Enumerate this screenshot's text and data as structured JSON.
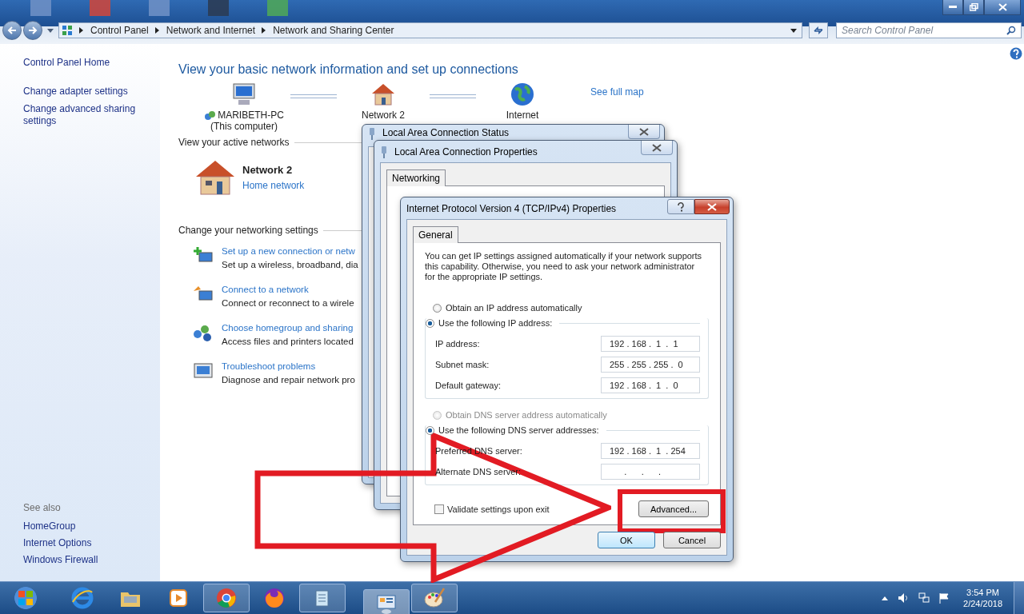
{
  "window": {
    "breadcrumb": [
      "Control Panel",
      "Network and Internet",
      "Network and Sharing Center"
    ],
    "search": {
      "placeholder": "Search Control Panel"
    }
  },
  "sidebar": {
    "items": [
      "Control Panel Home",
      "Change adapter settings",
      "Change advanced sharing settings"
    ],
    "see_also_title": "See also",
    "see_also": [
      "HomeGroup",
      "Internet Options",
      "Windows Firewall"
    ]
  },
  "main": {
    "heading": "View your basic network information and set up connections",
    "map": {
      "nodes": [
        {
          "kind": "computer",
          "label": "MARIBETH-PC",
          "sublabel": "(This computer)"
        },
        {
          "kind": "house",
          "label": "Network  2"
        },
        {
          "kind": "globe",
          "label": "Internet"
        }
      ],
      "full_map_link": "See full map"
    },
    "active_networks": {
      "title": "View your active networks",
      "name": "Network  2",
      "type": "Home network"
    },
    "settings": {
      "title": "Change your networking settings",
      "tasks": [
        {
          "kind": "new-connection",
          "link": "Set up a new connection or netw",
          "description": "Set up a wireless, broadband, dia"
        },
        {
          "kind": "connect",
          "link": "Connect to a network",
          "description": "Connect or reconnect to a wirele"
        },
        {
          "kind": "homegroup",
          "link": "Choose homegroup and sharing",
          "description": "Access files and printers located"
        },
        {
          "kind": "troubleshoot",
          "link": "Troubleshoot problems",
          "description": "Diagnose and repair network pro"
        }
      ]
    }
  },
  "dialogs": {
    "status": {
      "title": "Local Area Connection Status"
    },
    "properties": {
      "title": "Local Area Connection Properties",
      "tabs": [
        {
          "label": "Networking",
          "selected": true
        }
      ]
    },
    "ipv4": {
      "title": "Internet Protocol Version 4 (TCP/IPv4) Properties",
      "tabs": [
        {
          "label": "General",
          "selected": true
        }
      ],
      "description": "You can get IP settings assigned automatically if your network supports this capability. Otherwise, you need to ask your network administrator for the appropriate IP settings.",
      "ip_options": [
        {
          "label": "Obtain an IP address automatically",
          "selected": false,
          "disabled": false
        },
        {
          "label": "Use the following IP address:",
          "selected": true,
          "disabled": false
        }
      ],
      "ip_fields": [
        {
          "label": "IP address:",
          "value": "192 . 168 .  1  .  1"
        },
        {
          "label": "Subnet mask:",
          "value": "255 . 255 . 255 .  0"
        },
        {
          "label": "Default gateway:",
          "value": "192 . 168 .  1  .  0"
        }
      ],
      "dns_options": [
        {
          "label": "Obtain DNS server address automatically",
          "selected": false,
          "disabled": true
        },
        {
          "label": "Use the following DNS server addresses:",
          "selected": true,
          "disabled": false
        }
      ],
      "dns_fields": [
        {
          "label": "Preferred DNS server:",
          "value": "192 . 168 .  1  . 254"
        },
        {
          "label": "Alternate DNS server:",
          "value": "      .      .      .   "
        }
      ],
      "validate": {
        "label": "Validate settings upon exit",
        "checked": false
      },
      "advanced_button": "Advanced...",
      "ok_button": "OK",
      "cancel_button": "Cancel"
    }
  },
  "taskbar": {
    "apps": [
      {
        "kind": "ie",
        "running": false,
        "active": false
      },
      {
        "kind": "folder",
        "running": false,
        "active": false
      },
      {
        "kind": "media",
        "running": false,
        "active": false
      },
      {
        "kind": "chrome",
        "running": true,
        "active": false
      },
      {
        "kind": "firefox",
        "running": false,
        "active": false
      },
      {
        "kind": "notepad",
        "running": true,
        "active": false
      },
      {
        "kind": "control-panel",
        "running": true,
        "active": true
      },
      {
        "kind": "paint",
        "running": true,
        "active": false
      }
    ],
    "clock": {
      "time": "3:54 PM",
      "date": "2/24/2018"
    }
  }
}
